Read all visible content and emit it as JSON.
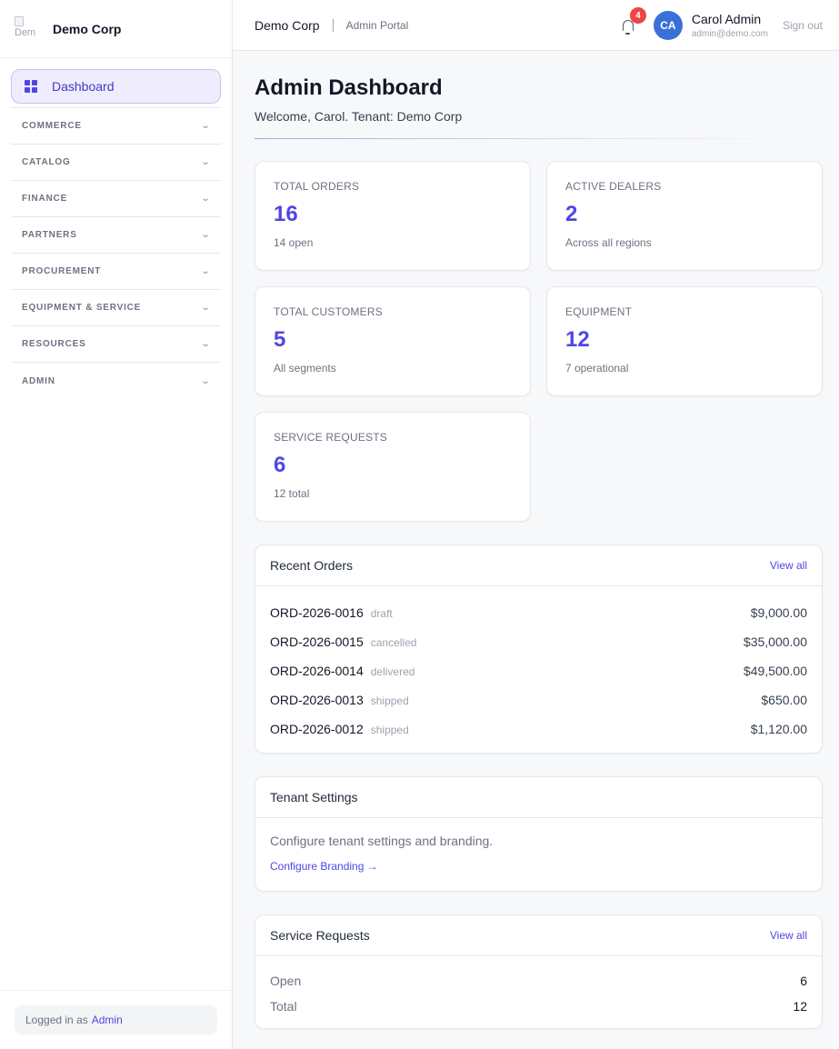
{
  "sidebar": {
    "brand": {
      "name": "Demo Corp",
      "logo_alt": "Dem"
    },
    "active_item": {
      "label": "Dashboard",
      "icon": "grid-icon"
    },
    "groups": [
      {
        "label": "COMMERCE"
      },
      {
        "label": "CATALOG"
      },
      {
        "label": "FINANCE"
      },
      {
        "label": "PARTNERS"
      },
      {
        "label": "PROCUREMENT"
      },
      {
        "label": "EQUIPMENT & SERVICE"
      },
      {
        "label": "RESOURCES"
      },
      {
        "label": "ADMIN"
      }
    ],
    "chevron": "⌄",
    "footer": {
      "prefix": "Logged in as",
      "role": "Admin"
    }
  },
  "header": {
    "company": "Demo Corp",
    "portal": "Admin Portal",
    "notification_count": "4",
    "user": {
      "initials": "CA",
      "name": "Carol Admin",
      "email": "admin@demo.com"
    },
    "signout_label": "Sign out"
  },
  "page": {
    "title": "Admin Dashboard",
    "subtitle": "Welcome, Carol. Tenant: Demo Corp"
  },
  "stats": [
    {
      "label": "TOTAL ORDERS",
      "value": "16",
      "sub": "14 open"
    },
    {
      "label": "ACTIVE DEALERS",
      "value": "2",
      "sub": "Across all regions"
    },
    {
      "label": "TOTAL CUSTOMERS",
      "value": "5",
      "sub": "All segments"
    },
    {
      "label": "EQUIPMENT",
      "value": "12",
      "sub": "7 operational"
    },
    {
      "label": "SERVICE REQUESTS",
      "value": "6",
      "sub": "12 total"
    }
  ],
  "recent_orders": {
    "title": "Recent Orders",
    "view_all": "View all",
    "rows": [
      {
        "id": "ORD-2026-0016",
        "status": "draft",
        "amount": "$9,000.00"
      },
      {
        "id": "ORD-2026-0015",
        "status": "cancelled",
        "amount": "$35,000.00"
      },
      {
        "id": "ORD-2026-0014",
        "status": "delivered",
        "amount": "$49,500.00"
      },
      {
        "id": "ORD-2026-0013",
        "status": "shipped",
        "amount": "$650.00"
      },
      {
        "id": "ORD-2026-0012",
        "status": "shipped",
        "amount": "$1,120.00"
      }
    ]
  },
  "tenant_settings": {
    "title": "Tenant Settings",
    "description": "Configure tenant settings and branding.",
    "link": "Configure Branding →"
  },
  "service_requests": {
    "title": "Service Requests",
    "view_all": "View all",
    "rows": [
      {
        "label": "Open",
        "value": "6"
      },
      {
        "label": "Total",
        "value": "12"
      }
    ]
  },
  "colors": {
    "accent": "#4f46e5",
    "badge": "#ef4444",
    "avatar": "#3b6fd8"
  }
}
